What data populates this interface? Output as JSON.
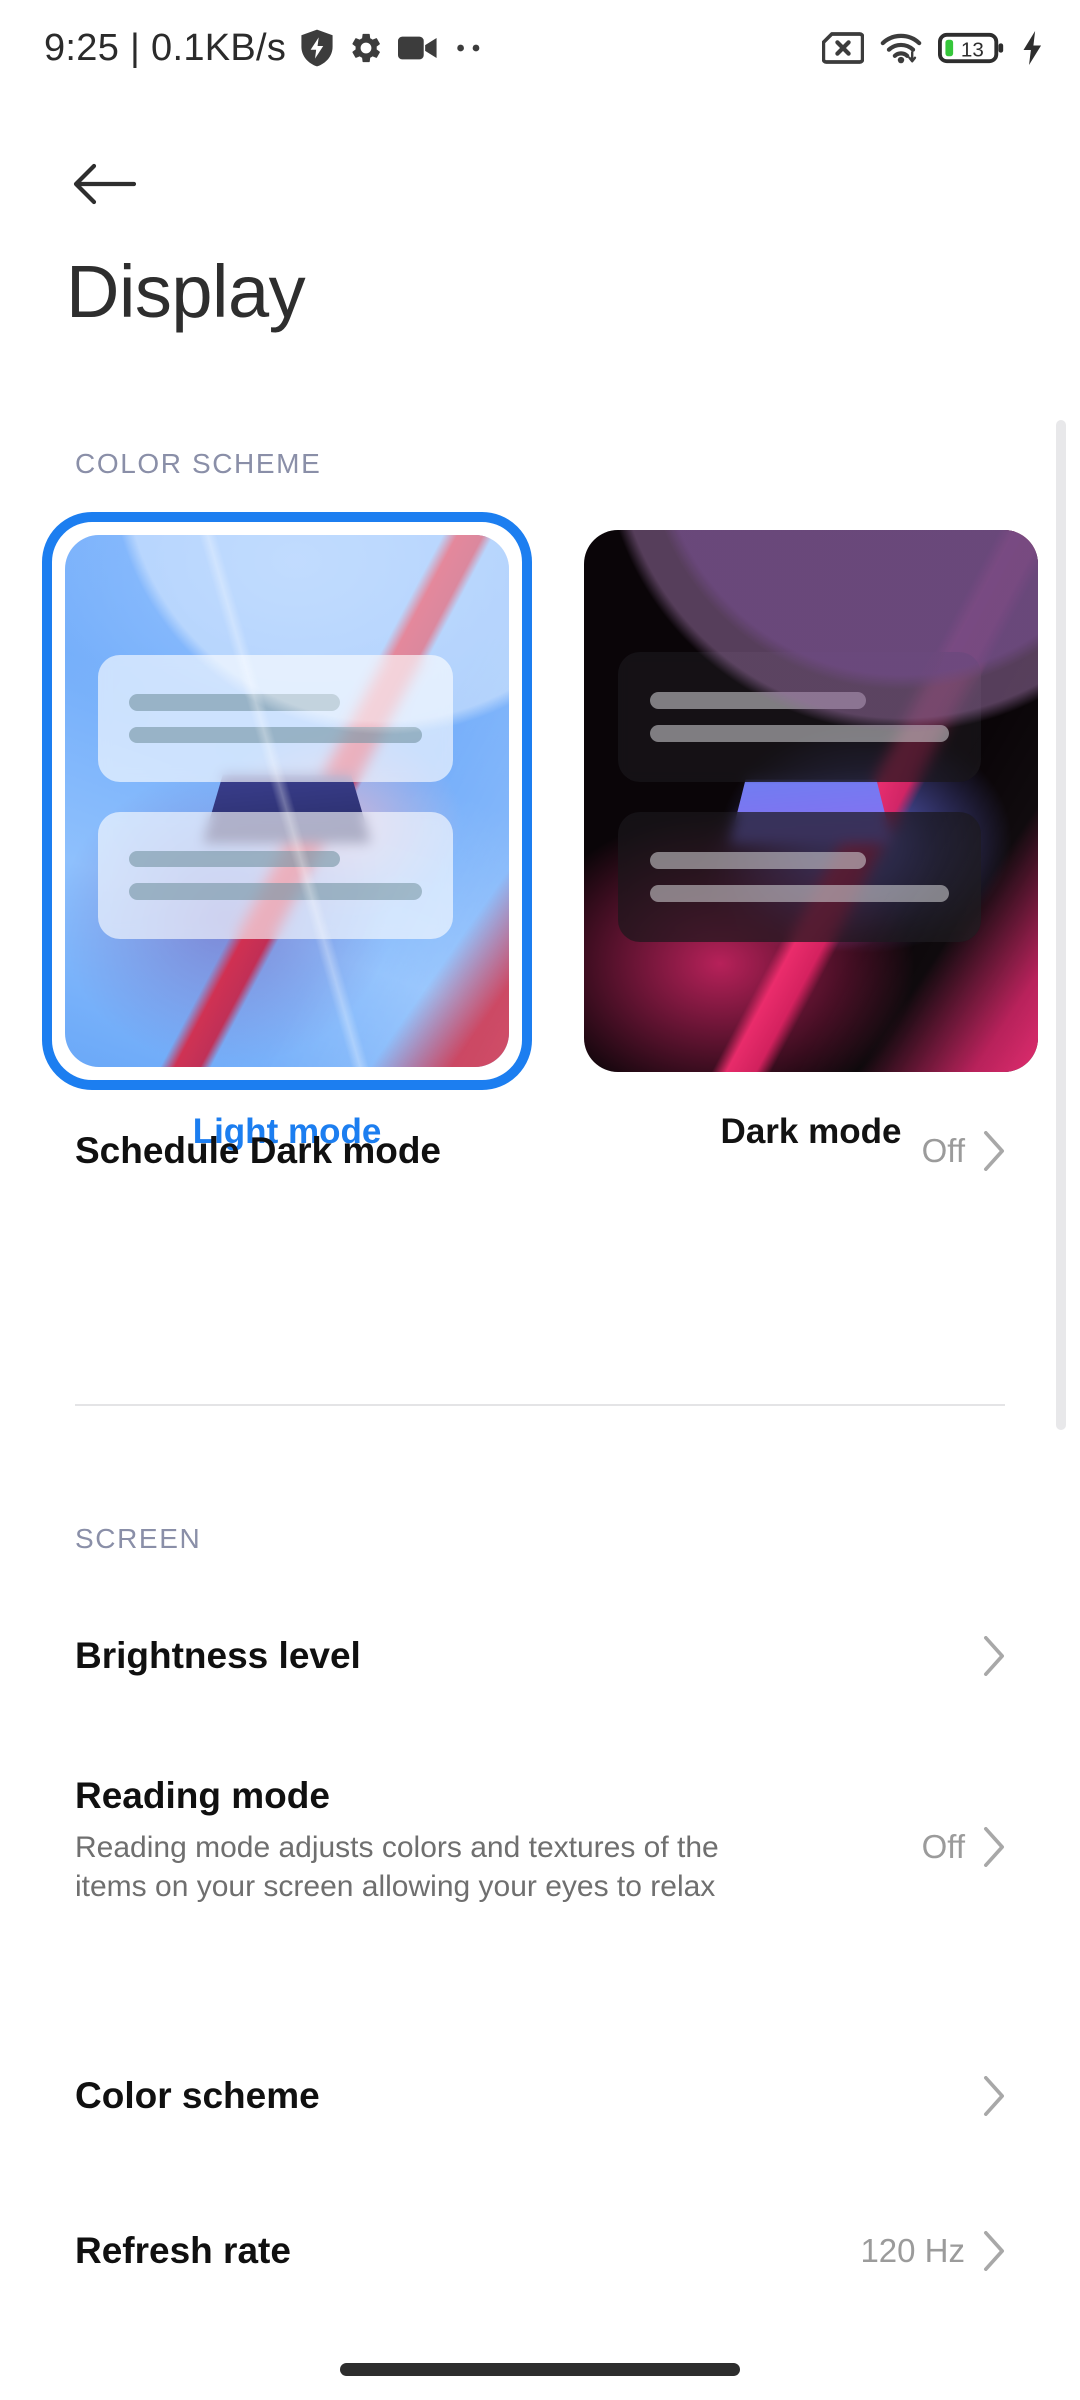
{
  "status_bar": {
    "clock_and_net": "9:25 | 0.1KB/s",
    "left_icons": [
      "shield-security-icon",
      "gear-icon",
      "video-camera-icon",
      "more-dots-icon"
    ],
    "right_icons": [
      "no-sim-icon",
      "wifi-icon",
      "battery-icon",
      "charging-bolt-icon"
    ],
    "battery_level": "13",
    "battery_fill_color": "#35c63a"
  },
  "header": {
    "back_icon": "arrow-left-icon",
    "title": "Display"
  },
  "color_scheme_section": {
    "label": "COLOR SCHEME",
    "selected": "Light mode",
    "accent_color": "#1c7ef0",
    "options": [
      {
        "label": "Light mode",
        "selected": true
      },
      {
        "label": "Dark mode",
        "selected": false
      }
    ],
    "schedule_row": {
      "title": "Schedule Dark mode",
      "value": "Off",
      "chevron": "chevron-right-icon"
    }
  },
  "screen_section": {
    "label": "SCREEN",
    "rows": [
      {
        "title": "Brightness level",
        "desc": "",
        "value": "",
        "chevron": "chevron-right-icon"
      },
      {
        "title": "Reading mode",
        "desc": "Reading mode adjusts colors and textures of the items on your screen allowing your eyes to relax",
        "value": "Off",
        "chevron": "chevron-right-icon"
      },
      {
        "title": "Color scheme",
        "desc": "",
        "value": "",
        "chevron": "chevron-right-icon"
      },
      {
        "title": "Refresh rate",
        "desc": "",
        "value": "120 Hz",
        "chevron": "chevron-right-icon"
      }
    ]
  },
  "navigation": {
    "home_indicator": "home-indicator"
  }
}
